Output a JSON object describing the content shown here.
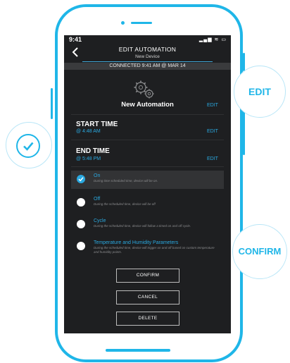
{
  "status_bar": {
    "time": "9:41",
    "icons": "▂▄▆ ≋ ▭"
  },
  "header": {
    "title": "EDIT AUTOMATION",
    "subtitle": "New Device",
    "back_icon": "chevron-left-icon"
  },
  "connection": {
    "text": "CONNECTED  9:41 AM @ MAR 14"
  },
  "automation": {
    "name": "New Automation",
    "edit_label": "EDIT",
    "icon": "gear-icon"
  },
  "start_time": {
    "label": "START TIME",
    "value": "@ 4:48 AM",
    "edit_label": "EDIT"
  },
  "end_time": {
    "label": "END TIME",
    "value": "@ 5:48 PM",
    "edit_label": "EDIT"
  },
  "options": [
    {
      "title": "On",
      "description": "During time scheduled time, device will be on.",
      "selected": true
    },
    {
      "title": "Off",
      "description": "During the scheduled time, device will be off",
      "selected": false
    },
    {
      "title": "Cycle",
      "description": "During the scheduled time, device will follow a timed on and off cycle.",
      "selected": false
    },
    {
      "title": "Temperature and Humidity Parameters",
      "description": "During the scheduled time, device will trigger on and off based on custom temperature and humidity points.",
      "selected": false
    }
  ],
  "buttons": {
    "confirm": "CONFIRM",
    "cancel": "CANCEL",
    "delete": "DELETE"
  },
  "callouts": {
    "edit": "EDIT",
    "confirm": "CONFIRM",
    "check_icon": "checkmark-icon"
  },
  "colors": {
    "accent": "#1fb6e8",
    "link": "#2aa9e0",
    "screen_bg": "#1e1f21"
  }
}
